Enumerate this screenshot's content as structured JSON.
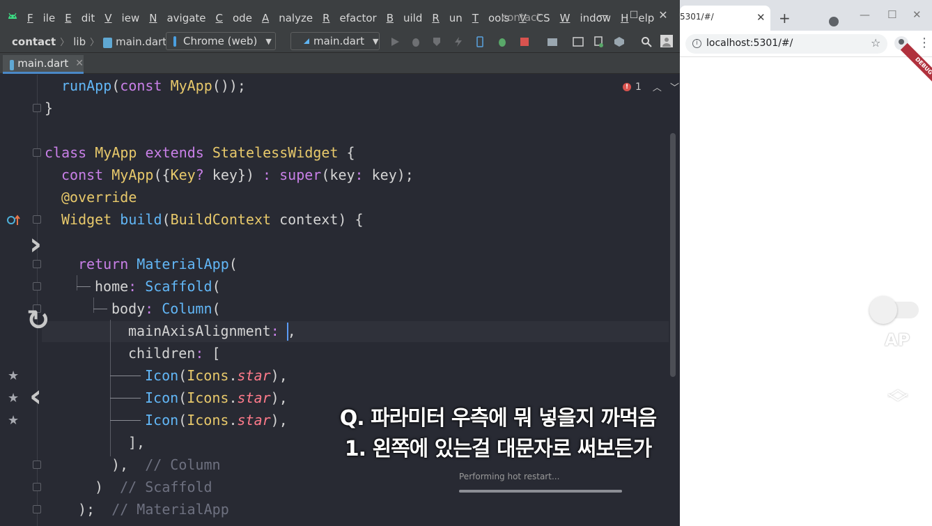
{
  "ide": {
    "menu": [
      "File",
      "Edit",
      "View",
      "Navigate",
      "Code",
      "Analyze",
      "Refactor",
      "Build",
      "Run",
      "Tools",
      "VCS",
      "Window",
      "Help"
    ],
    "window_title": "contact",
    "window_buttons": {
      "minimize": "—",
      "maximize": "☐",
      "close": "✕"
    },
    "breadcrumb": {
      "project": "contact",
      "folder": "lib",
      "file": "main.dart"
    },
    "device_selector": "Chrome (web)",
    "run_config": "main.dart",
    "editor_tab": "main.dart",
    "error_count": "1",
    "code": {
      "l1_fn": "runApp",
      "l1_kw": "const",
      "l1_ty": "MyApp",
      "l1_rest": "());",
      "l2": "}",
      "l4_kw1": "class",
      "l4_ty1": "MyApp",
      "l4_kw2": "extends",
      "l4_ty2": "StatelessWidget",
      "l4_rest": " {",
      "l5_kw": "const",
      "l5_ty": "MyApp",
      "l5_a": "({",
      "l5_ty2": "Key",
      "l5_q": "?",
      "l5_b": " key}) ",
      "l5_colon": ":",
      "l5_kw2": "super",
      "l5_c": "(key",
      "l5_colon2": ":",
      "l5_d": " key);",
      "l6": "@override",
      "l7_ty": "Widget",
      "l7_fn": "build",
      "l7_a": "(",
      "l7_ty2": "BuildContext",
      "l7_b": " context) {",
      "l9_kw": "return",
      "l9_fn": "MaterialApp",
      "l9_rest": "(",
      "l10_a": "home",
      "l10_colon": ":",
      "l10_fn": "Scaffold",
      "l10_rest": "(",
      "l11_a": "body",
      "l11_colon": ":",
      "l11_fn": "Column",
      "l11_rest": "(",
      "l12_a": "mainAxisAlignment",
      "l12_colon": ":",
      "l12_rest": " ,",
      "l13_a": "children",
      "l13_colon": ":",
      "l13_rest": " [",
      "icon_fn": "Icon",
      "icon_ty": "Icons",
      "icon_dot": ".",
      "icon_st": "star",
      "icon_rest": "),",
      "l17": "],",
      "l18_a": "),",
      "l18_cm": "// Column",
      "l19_a": ")",
      "l19_cm": "// Scaffold",
      "l20_a": ");",
      "l20_cm": "// MaterialApp"
    },
    "subtitle_line1": "Q. 파라미터 우측에 뭐 넣을지 까먹음",
    "subtitle_line2": "1. 왼쪽에 있는걸 대문자로 써보든가",
    "hot_restart_text": "Performing hot restart...",
    "hot_restart_progress": 1.0
  },
  "browser": {
    "tab_title": "5301/#/",
    "tab_close": "✕",
    "new_tab": "+",
    "url": "localhost:5301/#/",
    "debug_banner": "DEBUG",
    "app_label": "AP"
  },
  "colors": {
    "accent": "#4a88c7",
    "error": "#d9534f",
    "debug": "#b0313d"
  }
}
